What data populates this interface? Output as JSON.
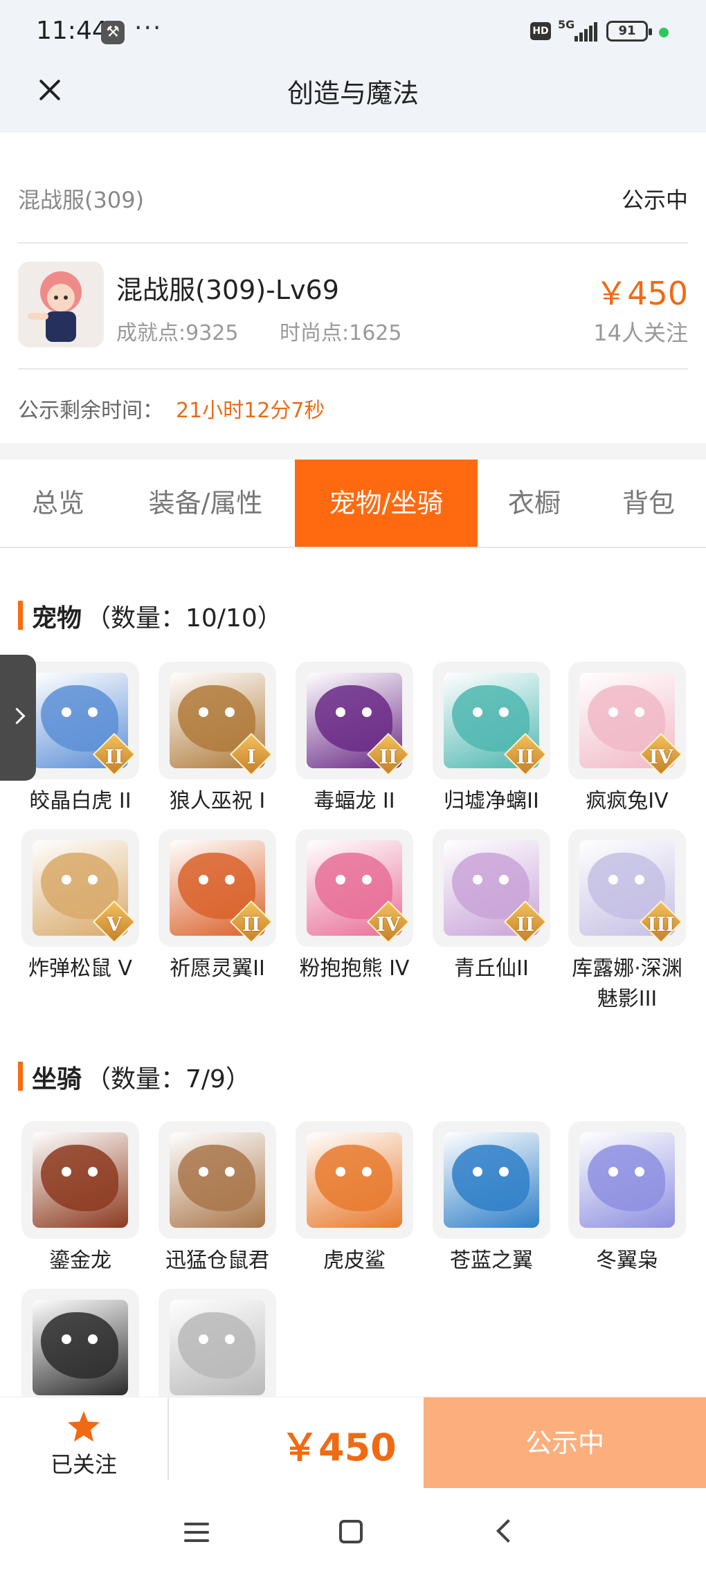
{
  "status_bar": {
    "time": "11:44",
    "network": "5G",
    "battery": "91"
  },
  "header": {
    "title": "创造与魔法"
  },
  "listing": {
    "server": "混战服(309)",
    "status": "公示中",
    "character_name": "混战服(309)-Lv69",
    "achievement": "成就点:9325",
    "fashion": "时尚点:1625",
    "price": "￥450",
    "followers": "14人关注",
    "remaining_label": "公示剩余时间：",
    "remaining_value": "21小时12分7秒"
  },
  "tabs": [
    {
      "label": "总览",
      "active": false
    },
    {
      "label": "装备/属性",
      "active": false
    },
    {
      "label": "宠物/坐骑",
      "active": true
    },
    {
      "label": "衣橱",
      "active": false
    },
    {
      "label": "背包",
      "active": false
    }
  ],
  "pets": {
    "title": "宠物",
    "count": "（数量：10/10）",
    "items": [
      {
        "name": "皎晶白虎 II",
        "badge": "II",
        "color": "#5c8fd6"
      },
      {
        "name": "狼人巫祝 I",
        "badge": "I",
        "color": "#b07a3a"
      },
      {
        "name": "毒蝠龙 II",
        "badge": "II",
        "color": "#6a2a86"
      },
      {
        "name": "归墟净螭II",
        "badge": "II",
        "color": "#4fb7b0"
      },
      {
        "name": "疯疯兔IV",
        "badge": "IV",
        "color": "#f1b9c7"
      },
      {
        "name": "炸弹松鼠 V",
        "badge": "V",
        "color": "#d8a96a"
      },
      {
        "name": "祈愿灵翼II",
        "badge": "II",
        "color": "#d9612a"
      },
      {
        "name": "粉抱抱熊 IV",
        "badge": "IV",
        "color": "#e86f98"
      },
      {
        "name": "青丘仙II",
        "badge": "II",
        "color": "#c9a3d8"
      },
      {
        "name": "库露娜·深渊魅影III",
        "badge": "III",
        "color": "#c4bfe4"
      }
    ]
  },
  "mounts": {
    "title": "坐骑",
    "count": "（数量：7/9）",
    "items": [
      {
        "name": "鎏金龙",
        "color": "#8c3a1e"
      },
      {
        "name": "迅猛仓鼠君",
        "color": "#a9764a"
      },
      {
        "name": "虎皮鲨",
        "color": "#e77a2e"
      },
      {
        "name": "苍蓝之翼",
        "color": "#2f7fc8"
      },
      {
        "name": "冬翼枭",
        "color": "#8d8fe0"
      },
      {
        "name": "",
        "color": "#2b2b2b"
      },
      {
        "name": "",
        "color": "#b9b9b9"
      }
    ]
  },
  "action_bar": {
    "follow_label": "已关注",
    "price": "￥450",
    "cta_label": "公示中"
  },
  "colors": {
    "accent": "#ff6a10",
    "price": "#f06a13",
    "cta": "#fcaf7c"
  }
}
